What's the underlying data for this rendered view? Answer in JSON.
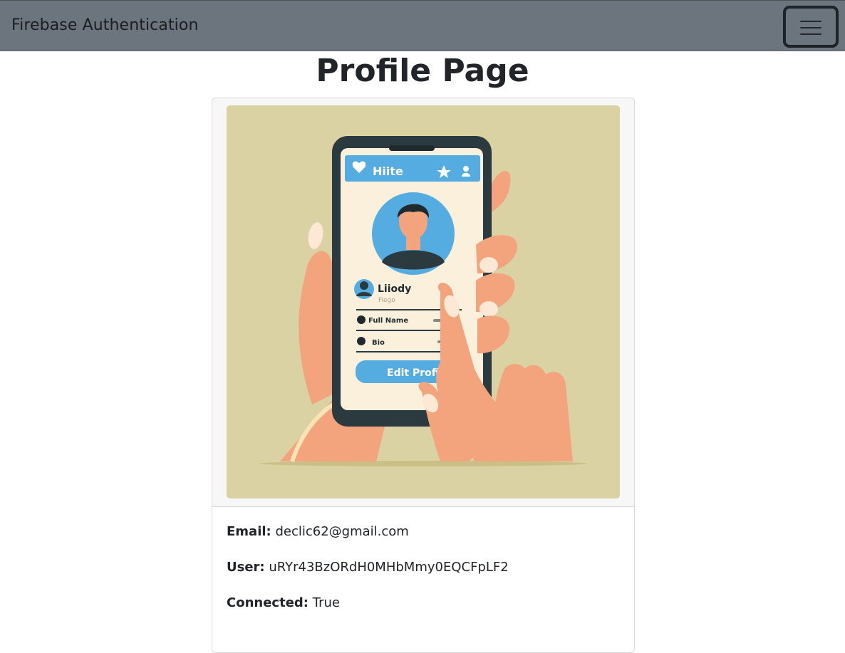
{
  "navbar": {
    "brand": "Firebase Authentication",
    "toggler_icon": "hamburger-menu-icon"
  },
  "page": {
    "title": "Profile Page"
  },
  "profile_image": {
    "app_header": "Hiite",
    "user_name": "Liiody",
    "user_sub": "Fiego",
    "field_1": "Full Name",
    "field_2": "Bio",
    "button": "Edit Profile",
    "colors": {
      "background": "#dbd2a4",
      "accent": "#55ace0",
      "skin": "#f3a47c",
      "phone": "#2b3a3f"
    }
  },
  "profile": {
    "email_label": "Email:",
    "email": "declic62@gmail.com",
    "user_label": "User:",
    "user": "uRYr43BzORdH0MHbMmy0EQCFpLF2",
    "connected_label": "Connected:",
    "connected": "True"
  }
}
